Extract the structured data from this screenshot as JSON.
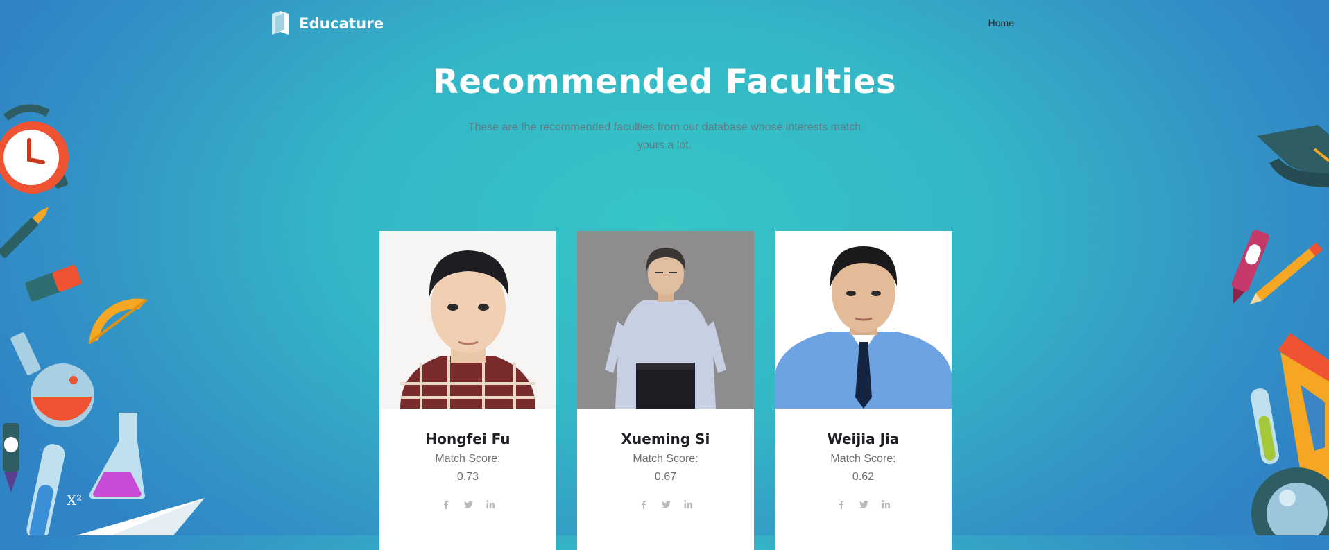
{
  "brand": {
    "name": "Educature"
  },
  "nav": {
    "home_label": "Home"
  },
  "hero": {
    "title": "Recommended Faculties",
    "subtitle": "These are the recommended faculties from our database whose interests match yours a lot."
  },
  "cards": [
    {
      "name": "Hongfei Fu",
      "score_label": "Match Score:",
      "score": "0.73"
    },
    {
      "name": "Xueming Si",
      "score_label": "Match Score:",
      "score": "0.67"
    },
    {
      "name": "Weijia Jia",
      "score_label": "Match Score:",
      "score": "0.62"
    }
  ],
  "decorations": {
    "formula_text": "X²"
  },
  "social_icons": [
    "facebook-icon",
    "twitter-icon",
    "linkedin-icon"
  ],
  "colors": {
    "accent": "#35c6c6",
    "card_bg": "#ffffff",
    "muted_text": "#6f6f6f"
  }
}
